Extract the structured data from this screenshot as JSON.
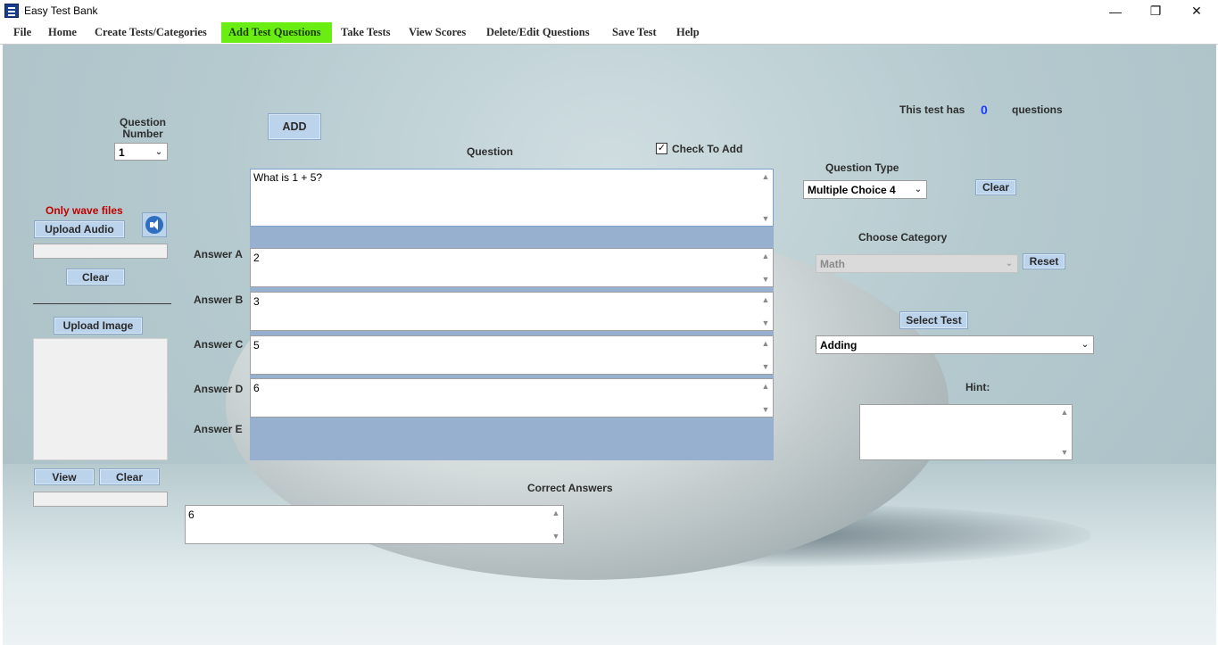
{
  "window": {
    "title": "Easy Test Bank",
    "controls": {
      "minimize": "—",
      "restore": "❐",
      "close": "✕"
    }
  },
  "menu": [
    {
      "label": "File",
      "active": false
    },
    {
      "label": "Home",
      "active": false
    },
    {
      "label": "Create Tests/Categories",
      "active": false
    },
    {
      "label": "Add Test Questions",
      "active": true
    },
    {
      "label": "Take Tests",
      "active": false
    },
    {
      "label": "View Scores",
      "active": false
    },
    {
      "label": "Delete/Edit Questions",
      "active": false
    },
    {
      "label": "Save Test",
      "active": false
    },
    {
      "label": "Help",
      "active": false
    }
  ],
  "colors": {
    "menu_active": "#69ed12",
    "button_fill": "#bcd3ec",
    "panel_blue": "#97b0cf",
    "count_blue": "#1a3cff",
    "warning_red": "#c00000"
  },
  "left_panel": {
    "question_number_label": "Question Number",
    "question_number_value": "1",
    "audio_warning": "Only wave files",
    "upload_audio_label": "Upload Audio",
    "audio_clear_label": "Clear",
    "upload_image_label": "Upload Image",
    "view_label": "View",
    "image_clear_label": "Clear"
  },
  "center": {
    "add_label": "ADD",
    "question_label": "Question",
    "check_to_add_label": "Check To Add",
    "check_to_add_checked": true,
    "question_text": "What is 1 + 5?",
    "answers": [
      {
        "label": "Answer A",
        "value": "2"
      },
      {
        "label": "Answer B",
        "value": "3"
      },
      {
        "label": "Answer C",
        "value": "5"
      },
      {
        "label": "Answer D",
        "value": "6"
      },
      {
        "label": "Answer E",
        "value": ""
      }
    ],
    "correct_answers_label": "Correct Answers",
    "correct_answers_value": "6"
  },
  "right_panel": {
    "test_has_label": "This test has",
    "question_count": "0",
    "questions_label": "questions",
    "question_type_label": "Question Type",
    "question_type_value": "Multiple Choice 4",
    "clear_label": "Clear",
    "choose_category_label": "Choose Category",
    "category_value": "Math",
    "reset_label": "Reset",
    "select_test_label": "Select Test",
    "test_value": "Adding",
    "hint_label": "Hint:",
    "hint_value": ""
  },
  "icons": {
    "scroll_up": "▲",
    "scroll_down": "▼",
    "dropdown_arrow": "⌄",
    "checkmark": "✓"
  }
}
